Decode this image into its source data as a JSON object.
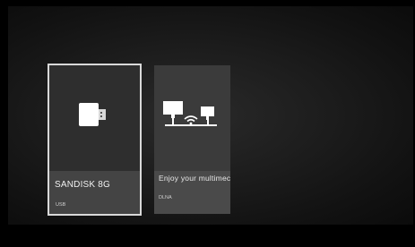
{
  "sources": [
    {
      "title": "SANDISK 8G",
      "type": "USB",
      "icon": "usb-drive-icon",
      "focused": true
    },
    {
      "title": "Enjoy your multimec",
      "type": "DLNA",
      "icon": "dlna-network-icon",
      "focused": false
    }
  ],
  "colors": {
    "background": "#000000",
    "card": "#343434",
    "focus_outline": "#d9d9d9"
  }
}
